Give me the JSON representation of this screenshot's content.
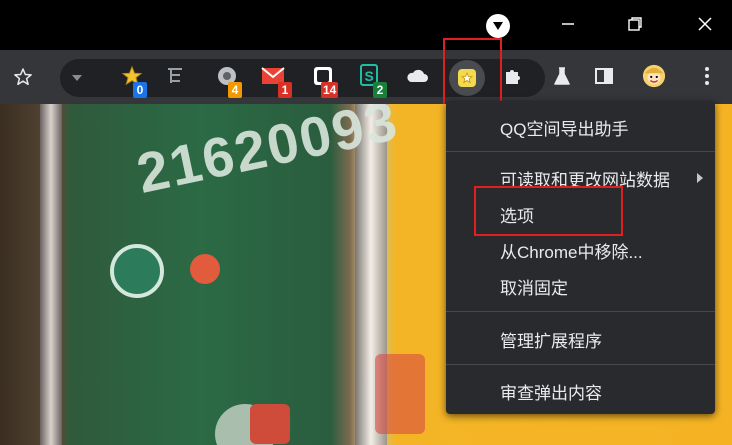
{
  "window": {
    "profile_dropdown_icon": "profile-dropdown-icon",
    "minimize_icon": "minimize-icon",
    "restore_icon": "restore-icon",
    "close_icon": "close-icon"
  },
  "toolbar": {
    "bookmark_icon": "star-icon",
    "extensions": [
      {
        "name": "star-extension",
        "badge": "0",
        "badge_color": "#1a73e8"
      },
      {
        "name": "tree-extension",
        "badge": ""
      },
      {
        "name": "circle-extension",
        "badge": "4",
        "badge_color": "#f29900"
      },
      {
        "name": "gmail-extension",
        "badge": "1",
        "badge_color": "#d93025"
      },
      {
        "name": "chat-extension",
        "badge": "14",
        "badge_color": "#d93025"
      },
      {
        "name": "s-extension",
        "badge": "2",
        "badge_color": "#188038"
      },
      {
        "name": "cloud-extension",
        "badge": ""
      },
      {
        "name": "qq-export-extension",
        "badge": ""
      }
    ],
    "puzzle_icon": "extensions-puzzle-icon",
    "lab_icon": "labs-flask-icon",
    "sidepanel_icon": "side-panel-icon",
    "avatar_icon": "profile-avatar",
    "menu_icon": "kebab-menu-icon"
  },
  "context_menu": {
    "items": [
      {
        "label": "QQ空间导出助手"
      },
      {
        "label": "可读取和更改网站数据",
        "has_submenu": true
      },
      {
        "label": "选项"
      },
      {
        "label": "从Chrome中移除..."
      },
      {
        "label": "取消固定"
      },
      {
        "label": "管理扩展程序"
      },
      {
        "label": "审查弹出内容"
      }
    ]
  },
  "photo": {
    "number_text": "21620093"
  },
  "colors": {
    "menu_bg": "#292a2d",
    "toolbar_bg": "#35363a",
    "highlight": "#e02020"
  }
}
